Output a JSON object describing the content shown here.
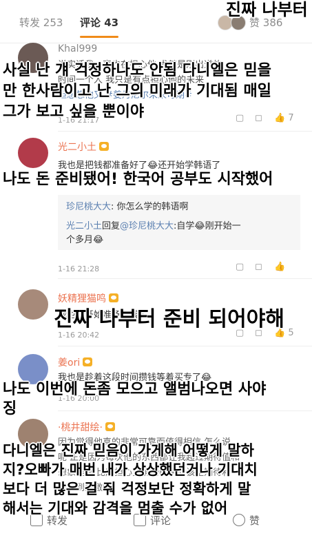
{
  "tabs": {
    "repost_label": "转发",
    "repost_count": "253",
    "comment_label": "评论",
    "comment_count": "43",
    "like_label": "赞",
    "like_count": "386"
  },
  "comments": [
    {
      "username": "Khal999",
      "text_lines": [
        "说实话我一直也在担心他 尤其是刚出道的",
        "时间一个人 我只是有点担心他的未来 ",
        "但想想他又 #姜丹尼尔未来可期#"
      ],
      "hashtag": "#姜丹尼尔未来可期#",
      "time": "1-16 21:17",
      "like_count": "7"
    },
    {
      "username": "光二小土",
      "text": "我也是把钱都准备好了😂还开始学韩语了",
      "time": "1-16 21:28",
      "replies": [
        {
          "user": "珍尼桃大大",
          "text": ": 你怎么学的韩语啊"
        },
        {
          "user": "光二小土",
          "prefix": "回复",
          "target": "@珍尼桃大大",
          "text": ":自学😂刚开始一",
          "text2": "个多月😂"
        }
      ]
    },
    {
      "username": "妖精狸猫鸣",
      "text": "我也要开始准备好钱了",
      "time": "1-16 20:42",
      "like_count": "5"
    },
    {
      "username": "姜ori",
      "text": "我也是趁着这段时间攒钱等着买专了😂",
      "time": "1-16 20:00"
    },
    {
      "username": "·桃井甜绘·",
      "text_lines": [
        "因为觉得他真的非常可靠而值得相信 怎么说",
        "呢 正是因为每次他的东西都让我超过期待值和",
        "想象程度 比起担心更确切的说应该是期待和",
        "喜欢到感激吧"
      ]
    }
  ],
  "subtitles": {
    "top": "진짜 나부터",
    "s1_line1": "사실 난 걔 걱정하나도 안됨 다니엘은 믿을",
    "s1_line2": "만 한사람이고 난 그의 미래가 기대됨 매일",
    "s1_line3": "그가 보고 싶을 뿐이야",
    "s2": "나도 돈 준비됐어! 한국어 공부도 시작했어",
    "s3": "진짜 나부터 준비 되어야해",
    "s4_line1": "나도 이번에 돈좀 모으고 앨범나오면 사야",
    "s4_line2": "징",
    "s5_line1": "다니엘은 진짜 믿음이 가게해 어떻게 말하",
    "s5_line2": "지?오빠가 매번 내가 상상했던거나 기대치",
    "s5_line3": "보다 더 많은 걸 줘 걱정보단 정확하게 말",
    "s5_line4": "해서는 기대와 감격을 멈출 수가 없어"
  },
  "bottombar": {
    "repost_label": "转发",
    "comment_label": "评论",
    "like_label": "赞"
  },
  "colors": {
    "accent": "#f08b19",
    "username": "#eb7350",
    "link": "#5a7fb0"
  }
}
